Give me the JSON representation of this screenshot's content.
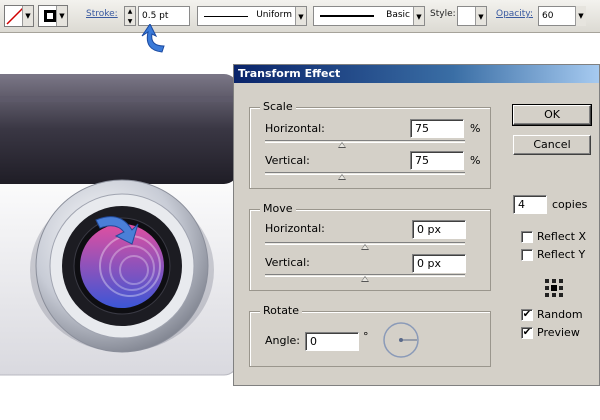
{
  "toolbar": {
    "fill_icon": "fill-none-swatch",
    "stroke_icon": "stroke-black-swatch",
    "stroke_label": "Stroke:",
    "stroke_weight": "0.5 pt",
    "variable_width_profile": "Uniform",
    "brush_definition": "Basic",
    "style_label": "Style:",
    "opacity_label": "Opacity:",
    "opacity_value": "60",
    "accent_color": "#3a5aa0"
  },
  "dialog": {
    "title": "Transform Effect",
    "scale": {
      "group_label": "Scale",
      "horizontal_label": "Horizontal:",
      "horizontal_value": "75",
      "horizontal_unit": "%",
      "vertical_label": "Vertical:",
      "vertical_value": "75",
      "vertical_unit": "%"
    },
    "move": {
      "group_label": "Move",
      "horizontal_label": "Horizontal:",
      "horizontal_value": "0 px",
      "vertical_label": "Vertical:",
      "vertical_value": "0 px"
    },
    "rotate": {
      "group_label": "Rotate",
      "angle_label": "Angle:",
      "angle_value": "0",
      "angle_unit": "°"
    },
    "buttons": {
      "ok": "OK",
      "cancel": "Cancel"
    },
    "copies_value": "4",
    "copies_label": "copies",
    "reflect_x_label": "Reflect X",
    "reflect_x_checked": false,
    "reflect_y_label": "Reflect Y",
    "reflect_y_checked": false,
    "random_label": "Random",
    "random_checked": true,
    "preview_label": "Preview",
    "preview_checked": true,
    "check_mark": "✔",
    "title_color": "#0a246a"
  },
  "artwork": {
    "description_icon": "camera-lens-icon",
    "lens_colors": [
      "#e04fa0",
      "#3b56d6"
    ]
  }
}
